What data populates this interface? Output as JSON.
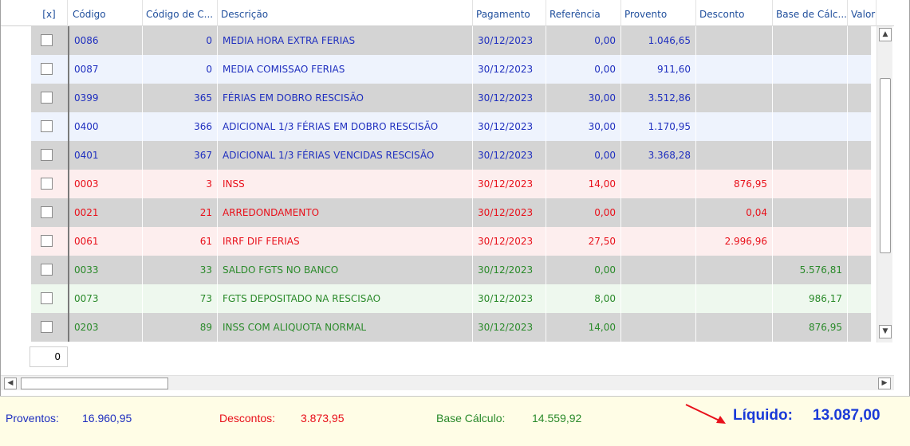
{
  "columns": [
    "[x]",
    "Código",
    "Código de C...",
    "Descrição",
    "Pagamento",
    "Referência",
    "Provento",
    "Desconto",
    "Base de Cálc...",
    "Valor For"
  ],
  "colors": {
    "blue": "#1f2fbf",
    "red": "#e8101a",
    "green": "#2a8a2a"
  },
  "rows": [
    {
      "codigo": "0086",
      "codc": "0",
      "descricao": "MEDIA HORA EXTRA FERIAS",
      "pagamento": "30/12/2023",
      "referencia": "0,00",
      "provento": "1.046,65",
      "desconto": "",
      "base": "",
      "type": "provento",
      "shade": "gray"
    },
    {
      "codigo": "0087",
      "codc": "0",
      "descricao": "MEDIA COMISSAO FERIAS",
      "pagamento": "30/12/2023",
      "referencia": "0,00",
      "provento": "911,60",
      "desconto": "",
      "base": "",
      "type": "provento",
      "shade": "light"
    },
    {
      "codigo": "0399",
      "codc": "365",
      "descricao": "FÉRIAS EM DOBRO RESCISÃO",
      "pagamento": "30/12/2023",
      "referencia": "30,00",
      "provento": "3.512,86",
      "desconto": "",
      "base": "",
      "type": "provento",
      "shade": "gray"
    },
    {
      "codigo": "0400",
      "codc": "366",
      "descricao": "ADICIONAL 1/3 FÉRIAS EM DOBRO RESCISÃO",
      "pagamento": "30/12/2023",
      "referencia": "30,00",
      "provento": "1.170,95",
      "desconto": "",
      "base": "",
      "type": "provento",
      "shade": "light"
    },
    {
      "codigo": "0401",
      "codc": "367",
      "descricao": "ADICIONAL 1/3 FÉRIAS VENCIDAS RESCISÃO",
      "pagamento": "30/12/2023",
      "referencia": "0,00",
      "provento": "3.368,28",
      "desconto": "",
      "base": "",
      "type": "provento",
      "shade": "gray"
    },
    {
      "codigo": "0003",
      "codc": "3",
      "descricao": "INSS",
      "pagamento": "30/12/2023",
      "referencia": "14,00",
      "provento": "",
      "desconto": "876,95",
      "base": "",
      "type": "desconto",
      "shade": "light"
    },
    {
      "codigo": "0021",
      "codc": "21",
      "descricao": "ARREDONDAMENTO",
      "pagamento": "30/12/2023",
      "referencia": "0,00",
      "provento": "",
      "desconto": "0,04",
      "base": "",
      "type": "desconto",
      "shade": "gray"
    },
    {
      "codigo": "0061",
      "codc": "61",
      "descricao": "IRRF DIF FERIAS",
      "pagamento": "30/12/2023",
      "referencia": "27,50",
      "provento": "",
      "desconto": "2.996,96",
      "base": "",
      "type": "desconto",
      "shade": "light"
    },
    {
      "codigo": "0033",
      "codc": "33",
      "descricao": "SALDO FGTS NO BANCO",
      "pagamento": "30/12/2023",
      "referencia": "0,00",
      "provento": "",
      "desconto": "",
      "base": "5.576,81",
      "type": "base",
      "shade": "gray"
    },
    {
      "codigo": "0073",
      "codc": "73",
      "descricao": "FGTS DEPOSITADO NA RESCISAO",
      "pagamento": "30/12/2023",
      "referencia": "8,00",
      "provento": "",
      "desconto": "",
      "base": "986,17",
      "type": "base",
      "shade": "light"
    },
    {
      "codigo": "0203",
      "codc": "89",
      "descricao": "INSS COM ALIQUOTA NORMAL",
      "pagamento": "30/12/2023",
      "referencia": "14,00",
      "provento": "",
      "desconto": "",
      "base": "876,95",
      "type": "base",
      "shade": "gray"
    }
  ],
  "page_value": "0",
  "totals": {
    "proventos_label": "Proventos:",
    "proventos_value": "16.960,95",
    "descontos_label": "Descontos:",
    "descontos_value": "3.873,95",
    "base_label": "Base Cálculo:",
    "base_value": "14.559,92",
    "liquido_label": "Líquido:",
    "liquido_value": "13.087,00"
  }
}
